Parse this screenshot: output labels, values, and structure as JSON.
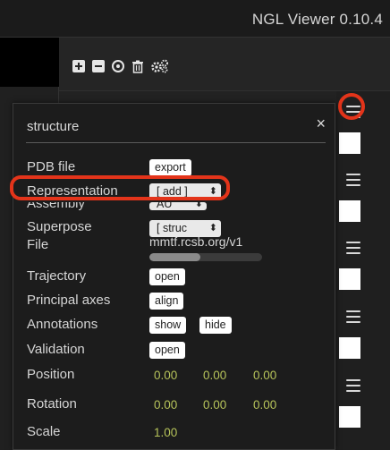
{
  "app": {
    "title": "NGL Viewer 0.10.4"
  },
  "toolbar": {
    "icons": [
      "plus-square-icon",
      "minus-square-icon",
      "target-icon",
      "trash-icon",
      "gears-icon"
    ]
  },
  "panel": {
    "title": "structure",
    "close_label": "×",
    "rows": {
      "pdb_file": {
        "label": "PDB file",
        "button": "export"
      },
      "representation": {
        "label": "Representation",
        "value": "[ add ]"
      },
      "assembly": {
        "label": "Assembly",
        "value": "AU"
      },
      "superpose": {
        "label": "Superpose",
        "value": "[ struc"
      },
      "file": {
        "label": "File",
        "value": "mmtf.rcsb.org/v1",
        "progress_fraction": 0.45
      },
      "trajectory": {
        "label": "Trajectory",
        "button": "open"
      },
      "principal_axes": {
        "label": "Principal axes",
        "button": "align"
      },
      "annotations": {
        "label": "Annotations",
        "show": "show",
        "hide": "hide"
      },
      "validation": {
        "label": "Validation",
        "button": "open"
      },
      "position": {
        "label": "Position",
        "x": "0.00",
        "y": "0.00",
        "z": "0.00"
      },
      "rotation": {
        "label": "Rotation",
        "x": "0.00",
        "y": "0.00",
        "z": "0.00"
      },
      "scale": {
        "label": "Scale",
        "value": "1.00"
      }
    }
  },
  "colors": {
    "highlight": "#e3341a",
    "value_text": "#b6c35a"
  }
}
